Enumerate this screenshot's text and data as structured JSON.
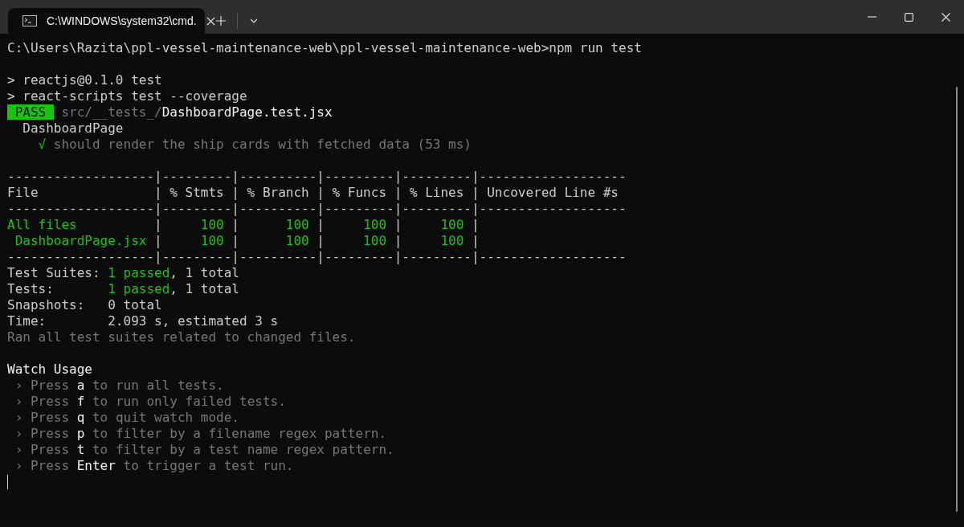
{
  "window": {
    "tab_title": "C:\\WINDOWS\\system32\\cmd.",
    "tab_selected": true
  },
  "terminal": {
    "lines": [
      {
        "kind": "text",
        "segments": [
          {
            "kind": "normal",
            "text": "C:\\Users\\Razita\\ppl-vessel-maintenance-web\\ppl-vessel-maintenance-web>npm run test"
          }
        ]
      },
      {
        "kind": "blank"
      },
      {
        "kind": "text",
        "segments": [
          {
            "kind": "normal",
            "text": "> reactjs@0.1.0 test"
          }
        ]
      },
      {
        "kind": "text",
        "segments": [
          {
            "kind": "normal",
            "text": "> react-scripts test --coverage"
          }
        ]
      },
      {
        "kind": "text",
        "segments": [
          {
            "kind": "badge",
            "text": " PASS "
          },
          {
            "kind": "dim",
            "text": " src/__tests_/"
          },
          {
            "kind": "bright",
            "text": "DashboardPage.test.jsx"
          }
        ]
      },
      {
        "kind": "text",
        "segments": [
          {
            "kind": "normal",
            "text": "  DashboardPage"
          }
        ]
      },
      {
        "kind": "text",
        "segments": [
          {
            "kind": "green",
            "text": "    √"
          },
          {
            "kind": "dim",
            "text": " should render the ship cards with fetched data (53 ms)"
          }
        ]
      },
      {
        "kind": "blank"
      },
      {
        "kind": "text",
        "segments": [
          {
            "kind": "normal",
            "text": "-------------------|---------|----------|---------|---------|-------------------"
          }
        ]
      },
      {
        "kind": "text",
        "segments": [
          {
            "kind": "normal",
            "text": "File               | % Stmts | % Branch | % Funcs | % Lines | Uncovered Line #s"
          }
        ]
      },
      {
        "kind": "text",
        "segments": [
          {
            "kind": "normal",
            "text": "-------------------|---------|----------|---------|---------|-------------------"
          }
        ]
      },
      {
        "kind": "text",
        "segments": [
          {
            "kind": "green",
            "text": "All files"
          },
          {
            "kind": "normal",
            "text": "          |"
          },
          {
            "kind": "green",
            "text": "     100"
          },
          {
            "kind": "normal",
            "text": " |"
          },
          {
            "kind": "green",
            "text": "      100"
          },
          {
            "kind": "normal",
            "text": " |"
          },
          {
            "kind": "green",
            "text": "     100"
          },
          {
            "kind": "normal",
            "text": " |"
          },
          {
            "kind": "green",
            "text": "     100"
          },
          {
            "kind": "normal",
            "text": " |"
          }
        ]
      },
      {
        "kind": "text",
        "segments": [
          {
            "kind": "green",
            "text": " DashboardPage.jsx"
          },
          {
            "kind": "normal",
            "text": " |"
          },
          {
            "kind": "green",
            "text": "     100"
          },
          {
            "kind": "normal",
            "text": " |"
          },
          {
            "kind": "green",
            "text": "      100"
          },
          {
            "kind": "normal",
            "text": " |"
          },
          {
            "kind": "green",
            "text": "     100"
          },
          {
            "kind": "normal",
            "text": " |"
          },
          {
            "kind": "green",
            "text": "     100"
          },
          {
            "kind": "normal",
            "text": " |"
          }
        ]
      },
      {
        "kind": "text",
        "segments": [
          {
            "kind": "normal",
            "text": "-------------------|---------|----------|---------|---------|-------------------"
          }
        ]
      },
      {
        "kind": "text",
        "segments": [
          {
            "kind": "normal",
            "text": "Test Suites: "
          },
          {
            "kind": "green",
            "text": "1 passed"
          },
          {
            "kind": "normal",
            "text": ", 1 total"
          }
        ]
      },
      {
        "kind": "text",
        "segments": [
          {
            "kind": "normal",
            "text": "Tests:       "
          },
          {
            "kind": "green",
            "text": "1 passed"
          },
          {
            "kind": "normal",
            "text": ", 1 total"
          }
        ]
      },
      {
        "kind": "text",
        "segments": [
          {
            "kind": "normal",
            "text": "Snapshots:   0 total"
          }
        ]
      },
      {
        "kind": "text",
        "segments": [
          {
            "kind": "normal",
            "text": "Time:        2.093 s, estimated 3 s"
          }
        ]
      },
      {
        "kind": "text",
        "segments": [
          {
            "kind": "dim",
            "text": "Ran all test suites related to changed files."
          }
        ]
      },
      {
        "kind": "blank"
      },
      {
        "kind": "text",
        "segments": [
          {
            "kind": "bright",
            "text": "Watch Usage"
          }
        ]
      },
      {
        "kind": "text",
        "segments": [
          {
            "kind": "dim",
            "text": " › Press "
          },
          {
            "kind": "bright",
            "text": "a"
          },
          {
            "kind": "dim",
            "text": " to run all tests."
          }
        ]
      },
      {
        "kind": "text",
        "segments": [
          {
            "kind": "dim",
            "text": " › Press "
          },
          {
            "kind": "bright",
            "text": "f"
          },
          {
            "kind": "dim",
            "text": " to run only failed tests."
          }
        ]
      },
      {
        "kind": "text",
        "segments": [
          {
            "kind": "dim",
            "text": " › Press "
          },
          {
            "kind": "bright",
            "text": "q"
          },
          {
            "kind": "dim",
            "text": " to quit watch mode."
          }
        ]
      },
      {
        "kind": "text",
        "segments": [
          {
            "kind": "dim",
            "text": " › Press "
          },
          {
            "kind": "bright",
            "text": "p"
          },
          {
            "kind": "dim",
            "text": " to filter by a filename regex pattern."
          }
        ]
      },
      {
        "kind": "text",
        "segments": [
          {
            "kind": "dim",
            "text": " › Press "
          },
          {
            "kind": "bright",
            "text": "t"
          },
          {
            "kind": "dim",
            "text": " to filter by a test name regex pattern."
          }
        ]
      },
      {
        "kind": "text",
        "segments": [
          {
            "kind": "dim",
            "text": " › Press "
          },
          {
            "kind": "bright",
            "text": "Enter"
          },
          {
            "kind": "dim",
            "text": " to trigger a test run."
          }
        ]
      }
    ]
  }
}
